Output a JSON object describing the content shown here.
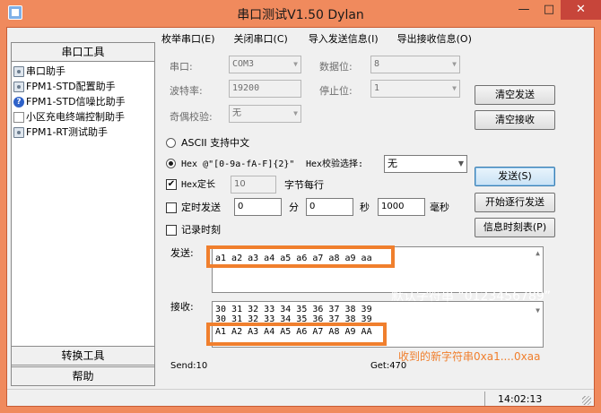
{
  "window": {
    "title": "串口测试V1.50 Dylan",
    "minimize": "—",
    "maximize": "□",
    "close": "✕"
  },
  "left_panel": {
    "header": "串口工具",
    "items": [
      {
        "label": "串口助手",
        "icon": "gear-icon"
      },
      {
        "label": "FPM1-STD配置助手",
        "icon": "gear-icon"
      },
      {
        "label": "FPM1-STD信噪比助手",
        "icon": "help-icon"
      },
      {
        "label": "小区充电终端控制助手",
        "icon": "document-icon"
      },
      {
        "label": "FPM1-RT测试助手",
        "icon": "gear-icon"
      }
    ],
    "convert_tools": "转换工具",
    "help": "帮助"
  },
  "menu": {
    "enum_ports": "枚举串口(E)",
    "close_port": "关闭串口(C)",
    "import_send": "导入发送信息(I)",
    "export_receive": "导出接收信息(O)"
  },
  "settings": {
    "port_label": "串口:",
    "port_value": "COM3",
    "baud_label": "波特率:",
    "baud_value": "19200",
    "parity_label": "奇偶校验:",
    "parity_value": "无",
    "databits_label": "数据位:",
    "databits_value": "8",
    "stopbits_label": "停止位:",
    "stopbits_value": "1"
  },
  "buttons": {
    "clear_send": "清空发送",
    "clear_receive": "清空接收",
    "send": "发送(S)",
    "start_line_send": "开始逐行发送",
    "info_timetable": "信息时刻表(P)"
  },
  "options": {
    "ascii_label": "ASCII 支持中文",
    "hex_label": "Hex @\"[0-9a-fA-F]{2}\"",
    "hex_check_label": "Hex校验选择:",
    "hex_check_value": "无",
    "hex_fixed_label": "Hex定长",
    "hex_fixed_value": "10",
    "bytes_per_line": "字节每行",
    "timed_send_label": "定时发送",
    "minutes_value": "0",
    "minutes_unit": "分",
    "seconds_value": "0",
    "seconds_unit": "秒",
    "ms_value": "1000",
    "ms_unit": "毫秒",
    "log_time_label": "记录时刻",
    "checkmark": "✔"
  },
  "send_area": {
    "label": "发送:",
    "content": "a1 a2 a3 a4 a5 a6 a7 a8 a9 aa"
  },
  "receive_area": {
    "label": "接收:",
    "lines": [
      "30 31 32 33 34 35 36 37 38 39",
      "30 31 32 33 34 35 36 37 38 39",
      "A1 A2 A3 A4 A5 A6 A7 A8 A9 AA"
    ]
  },
  "annotations": {
    "default_string": "默认字符串  “0123456789”",
    "new_string": "收到的新字符串0xa1....0xaa"
  },
  "status": {
    "send_count": "Send:10",
    "get_count": "Get:470",
    "time": "14:02:13"
  },
  "colors": {
    "title_bar": "#f08a5d",
    "highlight_box": "#f07f2d",
    "close_button": "#c7453a"
  }
}
